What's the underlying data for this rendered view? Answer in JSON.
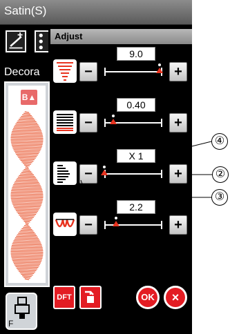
{
  "window": {
    "title": "Satin(S)"
  },
  "background": {
    "label": "Decora",
    "flip_tag": "B",
    "foot_button_label": "F",
    "icons": [
      "add-icon",
      "stitch-icon"
    ]
  },
  "dialog": {
    "title": "Adjust",
    "rows": [
      {
        "name": "width",
        "value": "9.0",
        "marker_fraction": 0.95,
        "minus": "−",
        "plus": "+"
      },
      {
        "name": "density",
        "value": "0.40",
        "marker_fraction": 0.15,
        "minus": "−",
        "plus": "+"
      },
      {
        "name": "elongation",
        "value": "X 1",
        "marker_fraction": 0.0,
        "minus": "−",
        "plus": "+"
      },
      {
        "name": "stitch-length",
        "value": "2.2",
        "marker_fraction": 0.2,
        "minus": "−",
        "plus": "+"
      }
    ],
    "buttons": {
      "default": "DFT",
      "ok": "OK",
      "cancel": "×"
    }
  },
  "callouts": [
    "④",
    "②",
    "③"
  ],
  "colors": {
    "accent": "#e31c23",
    "marker": "#e8331f"
  }
}
